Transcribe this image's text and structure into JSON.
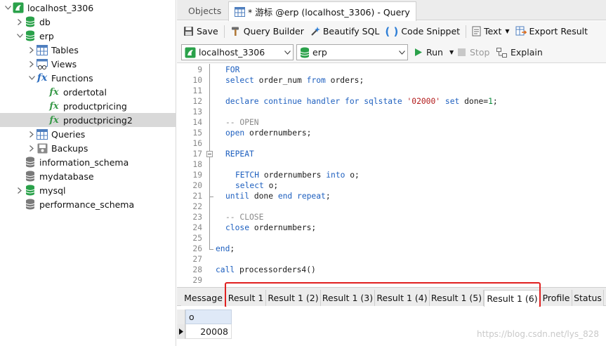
{
  "sidebar": {
    "items": [
      {
        "label": "localhost_3306",
        "arrow": "▾",
        "icon": "connection-icon"
      },
      {
        "label": "db",
        "arrow": "›",
        "icon": "database-icon"
      },
      {
        "label": "erp",
        "arrow": "▾",
        "icon": "database-icon"
      },
      {
        "label": "Tables",
        "arrow": "›",
        "icon": "tables-icon"
      },
      {
        "label": "Views",
        "arrow": "›",
        "icon": "views-icon"
      },
      {
        "label": "Functions",
        "arrow": "▾",
        "icon": "functions-icon"
      },
      {
        "label": "ordertotal",
        "arrow": "",
        "icon": "function-icon"
      },
      {
        "label": "productpricing",
        "arrow": "",
        "icon": "function-icon"
      },
      {
        "label": "productpricing2",
        "arrow": "",
        "icon": "function-icon",
        "selected": true
      },
      {
        "label": "Queries",
        "arrow": "›",
        "icon": "queries-icon"
      },
      {
        "label": "Backups",
        "arrow": "›",
        "icon": "backups-icon"
      },
      {
        "label": "information_schema",
        "arrow": "",
        "icon": "database-gray-icon"
      },
      {
        "label": "mydatabase",
        "arrow": "",
        "icon": "database-gray-icon"
      },
      {
        "label": "mysql",
        "arrow": "›",
        "icon": "database-icon"
      },
      {
        "label": "performance_schema",
        "arrow": "",
        "icon": "database-gray-icon"
      }
    ]
  },
  "doc_tabs": {
    "objects": "Objects",
    "query": "* 游标 @erp (localhost_3306) - Query"
  },
  "toolbar": {
    "save": "Save",
    "query_builder": "Query Builder",
    "beautify": "Beautify SQL",
    "code_snippet": "Code Snippet",
    "text": "Text",
    "export": "Export Result"
  },
  "conn_bar": {
    "connection": "localhost_3306",
    "database": "erp",
    "run": "Run",
    "stop": "Stop",
    "explain": "Explain"
  },
  "editor": {
    "lines": [
      {
        "n": "9",
        "indent": 1,
        "parts": [
          [
            "kw",
            "FOR"
          ]
        ]
      },
      {
        "n": "10",
        "indent": 1,
        "parts": [
          [
            "kw",
            "select"
          ],
          [
            "",
            " order_num "
          ],
          [
            "kw",
            "from"
          ],
          [
            "",
            " orders;"
          ]
        ]
      },
      {
        "n": "11",
        "indent": 0,
        "parts": []
      },
      {
        "n": "12",
        "indent": 1,
        "parts": [
          [
            "kw",
            "declare continue handler for sqlstate"
          ],
          [
            "",
            " "
          ],
          [
            "str",
            "'02000'"
          ],
          [
            "",
            " "
          ],
          [
            "kw",
            "set"
          ],
          [
            "",
            " done="
          ],
          [
            "num",
            "1"
          ],
          [
            "",
            ";"
          ]
        ]
      },
      {
        "n": "13",
        "indent": 0,
        "parts": []
      },
      {
        "n": "14",
        "indent": 1,
        "parts": [
          [
            "cmt",
            "-- OPEN"
          ]
        ]
      },
      {
        "n": "15",
        "indent": 1,
        "parts": [
          [
            "kw",
            "open"
          ],
          [
            "",
            " ordernumbers;"
          ]
        ]
      },
      {
        "n": "16",
        "indent": 0,
        "parts": []
      },
      {
        "n": "17",
        "indent": 1,
        "parts": [
          [
            "kw",
            "REPEAT"
          ]
        ]
      },
      {
        "n": "18",
        "indent": 0,
        "parts": []
      },
      {
        "n": "19",
        "indent": 2,
        "parts": [
          [
            "kw",
            "FETCH"
          ],
          [
            "",
            " ordernumbers "
          ],
          [
            "kw",
            "into"
          ],
          [
            "",
            " o;"
          ]
        ]
      },
      {
        "n": "20",
        "indent": 2,
        "parts": [
          [
            "kw",
            "select"
          ],
          [
            "",
            " o;"
          ]
        ]
      },
      {
        "n": "21",
        "indent": 1,
        "parts": [
          [
            "kw",
            "until"
          ],
          [
            "",
            " done "
          ],
          [
            "kw",
            "end repeat"
          ],
          [
            "",
            ";"
          ]
        ]
      },
      {
        "n": "22",
        "indent": 0,
        "parts": []
      },
      {
        "n": "23",
        "indent": 1,
        "parts": [
          [
            "cmt",
            "-- CLOSE"
          ]
        ]
      },
      {
        "n": "24",
        "indent": 1,
        "parts": [
          [
            "kw",
            "close"
          ],
          [
            "",
            " ordernumbers;"
          ]
        ]
      },
      {
        "n": "25",
        "indent": 0,
        "parts": []
      },
      {
        "n": "26",
        "indent": 0,
        "parts": [
          [
            "kw",
            "end"
          ],
          [
            "",
            ";"
          ]
        ]
      },
      {
        "n": "27",
        "indent": 0,
        "parts": []
      },
      {
        "n": "28",
        "indent": 0,
        "parts": [
          [
            "kw",
            "call"
          ],
          [
            "",
            " processorders4()"
          ]
        ]
      },
      {
        "n": "29",
        "indent": 0,
        "parts": []
      }
    ]
  },
  "result_tabs": [
    "Message",
    "Result 1",
    "Result 1 (2)",
    "Result 1 (3)",
    "Result 1 (4)",
    "Result 1 (5)",
    "Result 1 (6)",
    "Profile",
    "Status"
  ],
  "grid": {
    "column": "o",
    "value": "20008"
  },
  "watermark": "https://blog.csdn.net/lys_828",
  "colors": {
    "accent_green": "#2aa14a",
    "keyword_blue": "#1d5fbf",
    "highlight_red": "#e02020"
  }
}
